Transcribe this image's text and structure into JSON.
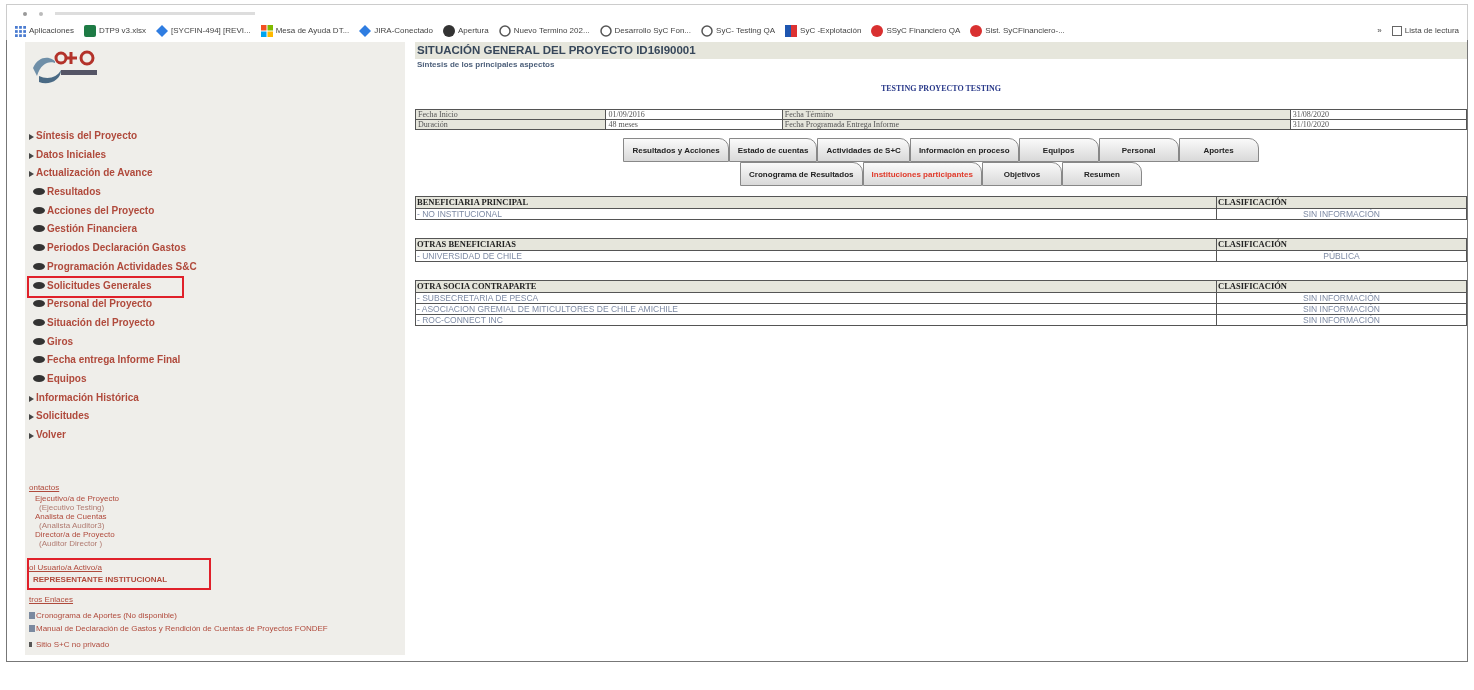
{
  "bookmarks": [
    {
      "label": "Aplicaciones"
    },
    {
      "label": "DTP9 v3.xlsx"
    },
    {
      "label": "[SYCFIN-494] [REVI..."
    },
    {
      "label": "Mesa de Ayuda DT..."
    },
    {
      "label": "JIRA-Conectado"
    },
    {
      "label": "Apertura"
    },
    {
      "label": "Nuevo Termino 202..."
    },
    {
      "label": "Desarrollo SyC Fon..."
    },
    {
      "label": "SyC- Testing QA"
    },
    {
      "label": "SyC -Explotación"
    },
    {
      "label": "SSyC Financiero QA"
    },
    {
      "label": "Sist. SyCFinanciero-..."
    }
  ],
  "bookmarks_more": "»",
  "reading_list": "Lista de lectura",
  "sidebar": {
    "menu": [
      {
        "label": "Síntesis del Proyecto",
        "kind": "section",
        "highlighted": false
      },
      {
        "label": "Datos Iniciales",
        "kind": "section",
        "highlighted": false
      },
      {
        "label": "Actualización de Avance",
        "kind": "section",
        "highlighted": false
      },
      {
        "label": "Resultados",
        "kind": "sub",
        "highlighted": false
      },
      {
        "label": "Acciones del Proyecto",
        "kind": "sub",
        "highlighted": false
      },
      {
        "label": "Gestión Financiera",
        "kind": "sub",
        "highlighted": false
      },
      {
        "label": "Periodos Declaración Gastos",
        "kind": "sub",
        "highlighted": false
      },
      {
        "label": "Programación Actividades S&C",
        "kind": "sub",
        "highlighted": false
      },
      {
        "label": "Solicitudes Generales",
        "kind": "sub",
        "highlighted": true
      },
      {
        "label": "Personal del Proyecto",
        "kind": "sub",
        "highlighted": false
      },
      {
        "label": "Situación del Proyecto",
        "kind": "sub",
        "highlighted": false
      },
      {
        "label": "Giros",
        "kind": "sub",
        "highlighted": false
      },
      {
        "label": "Fecha entrega Informe Final",
        "kind": "sub",
        "highlighted": false
      },
      {
        "label": "Equipos",
        "kind": "sub",
        "highlighted": false
      },
      {
        "label": "Información Histórica",
        "kind": "section",
        "highlighted": false
      },
      {
        "label": "Solicitudes",
        "kind": "section",
        "highlighted": false
      },
      {
        "label": "Volver",
        "kind": "section",
        "highlighted": false
      }
    ],
    "contacts_heading": "ontactos",
    "contacts": [
      {
        "role": "Ejecutivo/a de Proyecto",
        "name": "(Ejecutivo Testing)"
      },
      {
        "role": "Analista de Cuentas",
        "name": "(Analista Auditor3)"
      },
      {
        "role": "Director/a de Proyecto",
        "name": "(Auditor Director )"
      }
    ],
    "user": {
      "heading": "ol Usuario/a Activo/a",
      "role": "REPRESENTANTE INSTITUCIONAL",
      "highlighted": true
    },
    "links_heading": "tros Enlaces",
    "links": [
      "Cronograma de Aportes (No disponible)",
      "Manual de Declaración de Gastos y Rendición de Cuentas de Proyectos FONDEF"
    ],
    "public_site": "Sitio S+C no privado"
  },
  "title": "SITUACIÓN GENERAL DEL PROYECTO ID16I90001",
  "subtitle": "Síntesis de los principales aspectos",
  "project_name": "TESTING PROYECTO TESTING",
  "info_rows": [
    [
      "Fecha Inicio",
      "01/09/2016",
      "Fecha Término",
      "31/08/2020"
    ],
    [
      "Duración",
      "48 meses",
      "Fecha Programada Entrega Informe",
      "31/10/2020"
    ]
  ],
  "tab_rows": [
    [
      {
        "label": "Resultados y Acciones",
        "selected": false
      },
      {
        "label": "Estado de cuentas",
        "selected": false
      },
      {
        "label": "Actividades de S+C",
        "selected": false
      },
      {
        "label": "Información en proceso",
        "selected": false
      },
      {
        "label": "Equipos",
        "selected": false
      },
      {
        "label": "Personal",
        "selected": false
      },
      {
        "label": "Aportes",
        "selected": false
      }
    ],
    [
      {
        "label": "Cronograma de Resultados",
        "selected": false
      },
      {
        "label": "Instituciones participantes",
        "selected": true
      },
      {
        "label": "Objetivos",
        "selected": false
      },
      {
        "label": "Resumen",
        "selected": false
      }
    ]
  ],
  "tables": [
    {
      "heading": "BENEFICIARIA PRINCIPAL",
      "class_heading": "CLASIFICACIÓN",
      "rows": [
        [
          "- NO INSTITUCIONAL",
          "SIN INFORMACIÓN"
        ]
      ]
    },
    {
      "heading": "OTRAS BENEFICIARIAS",
      "class_heading": "CLASIFICACIÓN",
      "rows": [
        [
          "- UNIVERSIDAD DE CHILE",
          "PÚBLICA"
        ]
      ]
    },
    {
      "heading": "OTRA SOCIA CONTRAPARTE",
      "class_heading": "CLASIFICACIÓN",
      "rows": [
        [
          "- SUBSECRETARIA DE PESCA",
          "SIN INFORMACIÓN"
        ],
        [
          "- ASOCIACION GREMIAL DE MITICULTORES DE CHILE AMICHILE",
          "SIN INFORMACIÓN"
        ],
        [
          "- ROC-CONNECT INC",
          "SIN INFORMACIÓN"
        ]
      ]
    }
  ]
}
